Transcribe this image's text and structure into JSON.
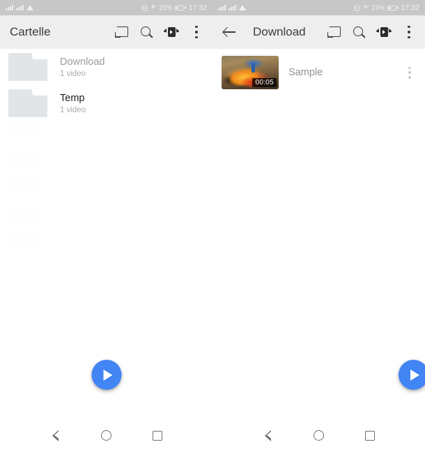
{
  "left_screen": {
    "status_bar": {
      "signal_icon": "signal-bars-icon",
      "wifi_icon": "wifi-icon",
      "dnd_icon": "do-not-disturb-icon",
      "bluetooth_glyph": "✶",
      "battery_percent": "23%",
      "time": "17:32"
    },
    "toolbar": {
      "title": "Cartelle",
      "cast_label": "cast-icon",
      "search_label": "search-icon",
      "transfer_label": "transfer-playback-icon",
      "overflow_label": "overflow-menu-icon"
    },
    "folders": [
      {
        "name": "Download",
        "subtitle": "1 video",
        "dim": true
      },
      {
        "name": "Temp",
        "subtitle": "1 video",
        "dim": false
      }
    ],
    "fab": {
      "icon": "play-icon"
    }
  },
  "right_screen": {
    "status_bar": {
      "signal_icon": "signal-bars-icon",
      "wifi_icon": "wifi-icon",
      "dnd_icon": "do-not-disturb-icon",
      "bluetooth_glyph": "✶",
      "battery_percent": "23%",
      "time": "17:32"
    },
    "toolbar": {
      "back_label": "back-arrow-icon",
      "title": "Download",
      "cast_label": "cast-icon",
      "search_label": "search-icon",
      "transfer_label": "transfer-playback-icon",
      "overflow_label": "overflow-menu-icon"
    },
    "videos": [
      {
        "title": "Sample",
        "duration": "00:05"
      }
    ],
    "fab": {
      "icon": "play-icon"
    }
  },
  "nav_bar": {
    "back": "back-nav-icon",
    "home": "home-nav-icon",
    "recents": "recents-nav-icon"
  },
  "colors": {
    "accent": "#4285f4",
    "toolbar_bg": "#eeeeee",
    "status_bg": "#c7c7c7",
    "folder_icon": "#e2e5e8",
    "text_primary": "#202020",
    "text_dim": "#9a9a9a",
    "text_subtitle": "#a8acb0"
  }
}
